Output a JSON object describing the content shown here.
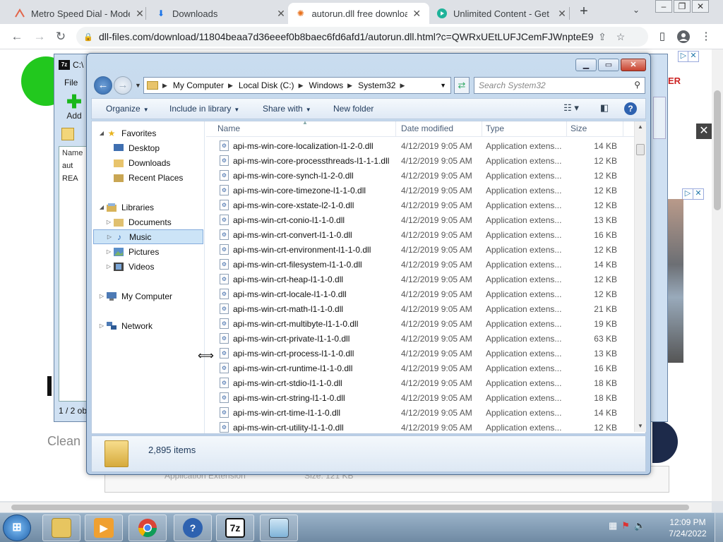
{
  "browser": {
    "tabs": [
      {
        "title": "Metro Speed Dial - Mode",
        "active": false
      },
      {
        "title": "Downloads",
        "active": false
      },
      {
        "title": "autorun.dll free downloa",
        "active": true
      },
      {
        "title": "Unlimited Content - Get",
        "active": false
      }
    ],
    "url": "dll-files.com/download/11804beaa7d36eeef0b8baec6fd6afd1/autorun.dll.html?c=QWRxUEtLUFJCemFJWnpteE9T..."
  },
  "webpage": {
    "partial_text_clean": "Clean",
    "partial_text_ter": "ER",
    "partial_type": "Application Extension",
    "partial_size": "Size: 121 KB"
  },
  "sevenzip": {
    "title": "C:\\",
    "menu_file": "File",
    "add_label": "Add",
    "col_name": "Name",
    "rows": [
      "aut",
      "REA"
    ],
    "status": "1 / 2 ob"
  },
  "explorer": {
    "breadcrumb": [
      "My Computer",
      "Local Disk (C:)",
      "Windows",
      "System32"
    ],
    "search_placeholder": "Search System32",
    "commands": {
      "organize": "Organize",
      "include": "Include in library",
      "share": "Share with",
      "new_folder": "New folder"
    },
    "nav": {
      "favorites": "Favorites",
      "desktop": "Desktop",
      "downloads": "Downloads",
      "recent": "Recent Places",
      "libraries": "Libraries",
      "documents": "Documents",
      "music": "Music",
      "pictures": "Pictures",
      "videos": "Videos",
      "computer": "My Computer",
      "network": "Network"
    },
    "columns": {
      "name": "Name",
      "date": "Date modified",
      "type": "Type",
      "size": "Size"
    },
    "files": [
      {
        "name": "api-ms-win-core-localization-l1-2-0.dll",
        "date": "4/12/2019 9:05 AM",
        "type": "Application extens...",
        "size": "14 KB"
      },
      {
        "name": "api-ms-win-core-processthreads-l1-1-1.dll",
        "date": "4/12/2019 9:05 AM",
        "type": "Application extens...",
        "size": "12 KB"
      },
      {
        "name": "api-ms-win-core-synch-l1-2-0.dll",
        "date": "4/12/2019 9:05 AM",
        "type": "Application extens...",
        "size": "12 KB"
      },
      {
        "name": "api-ms-win-core-timezone-l1-1-0.dll",
        "date": "4/12/2019 9:05 AM",
        "type": "Application extens...",
        "size": "12 KB"
      },
      {
        "name": "api-ms-win-core-xstate-l2-1-0.dll",
        "date": "4/12/2019 9:05 AM",
        "type": "Application extens...",
        "size": "12 KB"
      },
      {
        "name": "api-ms-win-crt-conio-l1-1-0.dll",
        "date": "4/12/2019 9:05 AM",
        "type": "Application extens...",
        "size": "13 KB"
      },
      {
        "name": "api-ms-win-crt-convert-l1-1-0.dll",
        "date": "4/12/2019 9:05 AM",
        "type": "Application extens...",
        "size": "16 KB"
      },
      {
        "name": "api-ms-win-crt-environment-l1-1-0.dll",
        "date": "4/12/2019 9:05 AM",
        "type": "Application extens...",
        "size": "12 KB"
      },
      {
        "name": "api-ms-win-crt-filesystem-l1-1-0.dll",
        "date": "4/12/2019 9:05 AM",
        "type": "Application extens...",
        "size": "14 KB"
      },
      {
        "name": "api-ms-win-crt-heap-l1-1-0.dll",
        "date": "4/12/2019 9:05 AM",
        "type": "Application extens...",
        "size": "12 KB"
      },
      {
        "name": "api-ms-win-crt-locale-l1-1-0.dll",
        "date": "4/12/2019 9:05 AM",
        "type": "Application extens...",
        "size": "12 KB"
      },
      {
        "name": "api-ms-win-crt-math-l1-1-0.dll",
        "date": "4/12/2019 9:05 AM",
        "type": "Application extens...",
        "size": "21 KB"
      },
      {
        "name": "api-ms-win-crt-multibyte-l1-1-0.dll",
        "date": "4/12/2019 9:05 AM",
        "type": "Application extens...",
        "size": "19 KB"
      },
      {
        "name": "api-ms-win-crt-private-l1-1-0.dll",
        "date": "4/12/2019 9:05 AM",
        "type": "Application extens...",
        "size": "63 KB"
      },
      {
        "name": "api-ms-win-crt-process-l1-1-0.dll",
        "date": "4/12/2019 9:05 AM",
        "type": "Application extens...",
        "size": "13 KB"
      },
      {
        "name": "api-ms-win-crt-runtime-l1-1-0.dll",
        "date": "4/12/2019 9:05 AM",
        "type": "Application extens...",
        "size": "16 KB"
      },
      {
        "name": "api-ms-win-crt-stdio-l1-1-0.dll",
        "date": "4/12/2019 9:05 AM",
        "type": "Application extens...",
        "size": "18 KB"
      },
      {
        "name": "api-ms-win-crt-string-l1-1-0.dll",
        "date": "4/12/2019 9:05 AM",
        "type": "Application extens...",
        "size": "18 KB"
      },
      {
        "name": "api-ms-win-crt-time-l1-1-0.dll",
        "date": "4/12/2019 9:05 AM",
        "type": "Application extens...",
        "size": "14 KB"
      },
      {
        "name": "api-ms-win-crt-utility-l1-1-0.dll",
        "date": "4/12/2019 9:05 AM",
        "type": "Application extens...",
        "size": "12 KB"
      }
    ],
    "item_count": "2,895 items"
  },
  "taskbar": {
    "sevenzip_label": "7z",
    "help_label": "?",
    "time": "12:09 PM",
    "date": "7/24/2022"
  },
  "colors": {
    "accent": "#2f66aa",
    "selection": "#cce4f7",
    "chrome_bg": "#dee1e6"
  }
}
